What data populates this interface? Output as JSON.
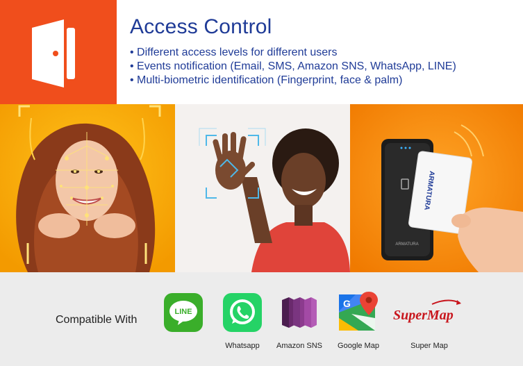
{
  "header": {
    "title": "Access Control",
    "bullets": [
      "• Different access levels for different users",
      "• Events notification (Email, SMS, Amazon SNS, WhatsApp, LINE)",
      "• Multi-biometric identification (Fingerprint, face & palm)"
    ]
  },
  "photos": {
    "card_brand": "ARMATURA",
    "device_brand": "ARMATURA"
  },
  "compatible": {
    "label": "Compatible With",
    "line_logo_text": "LINE",
    "supermap_logo_text": "SuperMap",
    "logos": [
      {
        "name": "LINE",
        "caption": ""
      },
      {
        "name": "Whatsapp",
        "caption": "Whatsapp"
      },
      {
        "name": "Amazon SNS",
        "caption": "Amazon SNS"
      },
      {
        "name": "Google Map",
        "caption": "Google Map"
      },
      {
        "name": "Super Map",
        "caption": "Super Map"
      }
    ]
  },
  "colors": {
    "accent": "#f04e1c",
    "title": "#1f3b97",
    "line_green": "#3aae2a",
    "whatsapp_green": "#25d366",
    "sns_purple": "#8c3b8e",
    "supermap_red": "#c8161d"
  }
}
